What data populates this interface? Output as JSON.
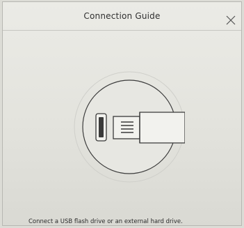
{
  "dialog": {
    "title": "Connection Guide",
    "close_icon": "close-icon"
  },
  "illustration": {
    "icon": "usb-drive-connect-icon"
  },
  "instruction": {
    "text": "Connect a USB flash drive or an external hard drive."
  }
}
